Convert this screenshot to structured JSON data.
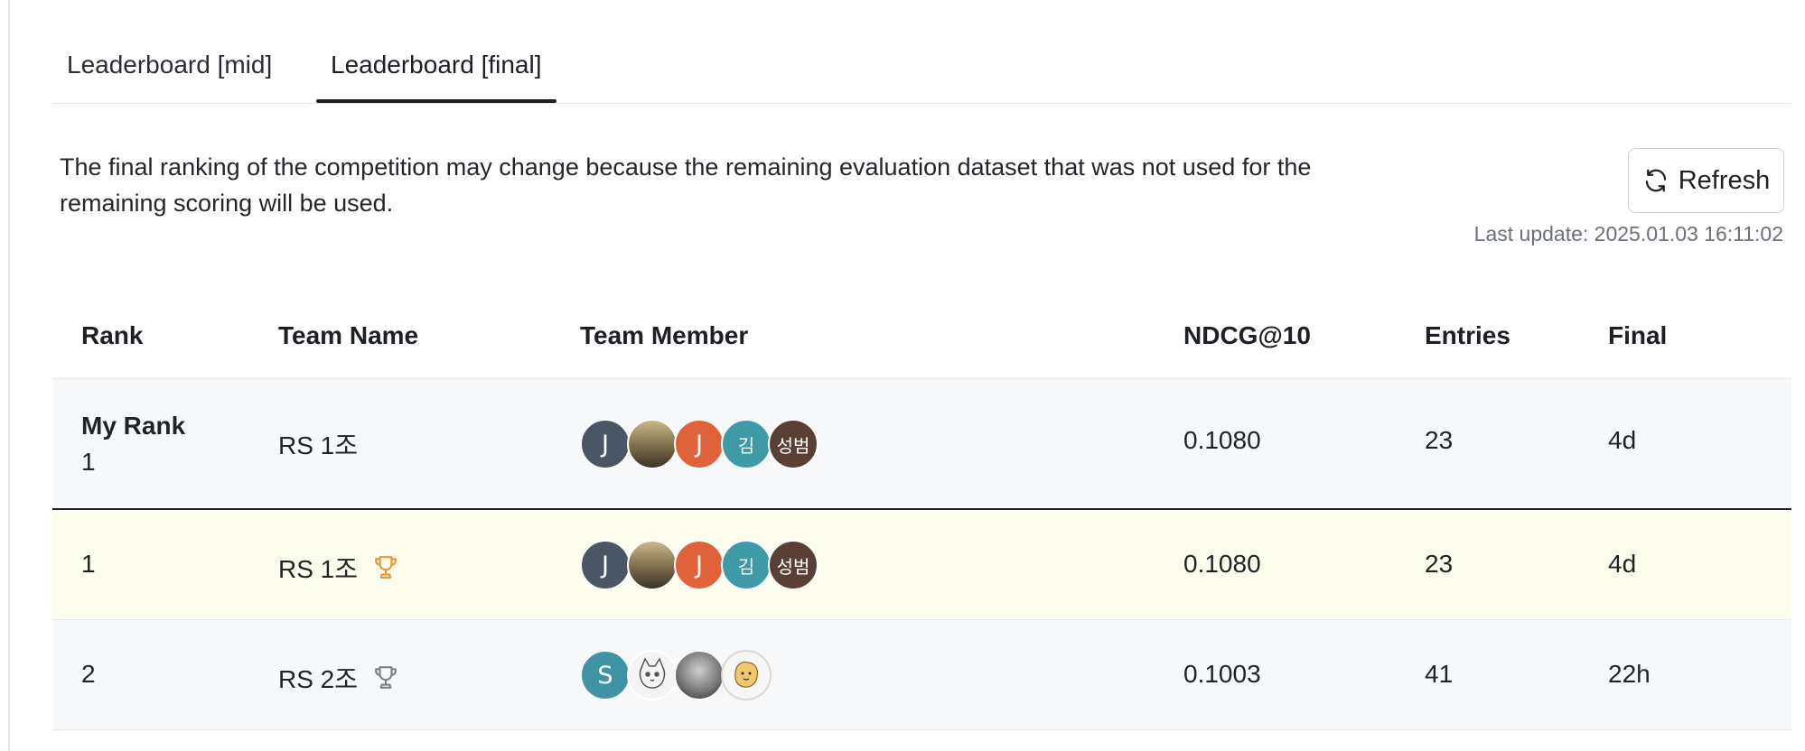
{
  "tabs": [
    {
      "label": "Leaderboard [mid]",
      "active": false
    },
    {
      "label": "Leaderboard [final]",
      "active": true
    }
  ],
  "notice": "The final ranking of the competition may change because the remaining evaluation dataset that was not used for the remaining scoring will be used.",
  "refresh_label": "Refresh",
  "last_update": "Last update: 2025.01.03 16:11:02",
  "columns": {
    "rank": "Rank",
    "team_name": "Team Name",
    "team_member": "Team Member",
    "metric": "NDCG@10",
    "entries": "Entries",
    "final": "Final"
  },
  "my_rank": {
    "label": "My Rank",
    "rank": "1",
    "team": "RS 1조",
    "score": "0.1080",
    "entries": "23",
    "final": "4d"
  },
  "rows": [
    {
      "rank": "1",
      "team": "RS 1조",
      "trophy": "gold-trophy-icon",
      "score": "0.1080",
      "entries": "23",
      "final": "4d"
    },
    {
      "rank": "2",
      "team": "RS 2조",
      "trophy": "silver-trophy-icon",
      "score": "0.1003",
      "entries": "41",
      "final": "22h"
    }
  ],
  "avatars": {
    "team1": [
      {
        "text": "J",
        "color": "#4a5663"
      },
      {
        "text": "",
        "color": "#8a7a55",
        "photo": "photo-avatar"
      },
      {
        "text": "J",
        "color": "#e0623a"
      },
      {
        "text": "김",
        "color": "#3f9aa8"
      },
      {
        "text": "성범",
        "color": "#5a3f35"
      }
    ],
    "team2": [
      {
        "text": "S",
        "color": "#3f93a4"
      },
      {
        "text": "",
        "color": "#f4f4f4",
        "photo": "cat-drawing-avatar"
      },
      {
        "text": "",
        "color": "#6f6f6f",
        "photo": "photo-avatar"
      },
      {
        "text": "",
        "color": "#f7f7f7",
        "photo": "character-drawing-avatar"
      }
    ]
  },
  "colors": {
    "gold_trophy": "#e8953a",
    "silver_trophy": "#7d828a",
    "first_row_bg": "#fdfdee"
  }
}
